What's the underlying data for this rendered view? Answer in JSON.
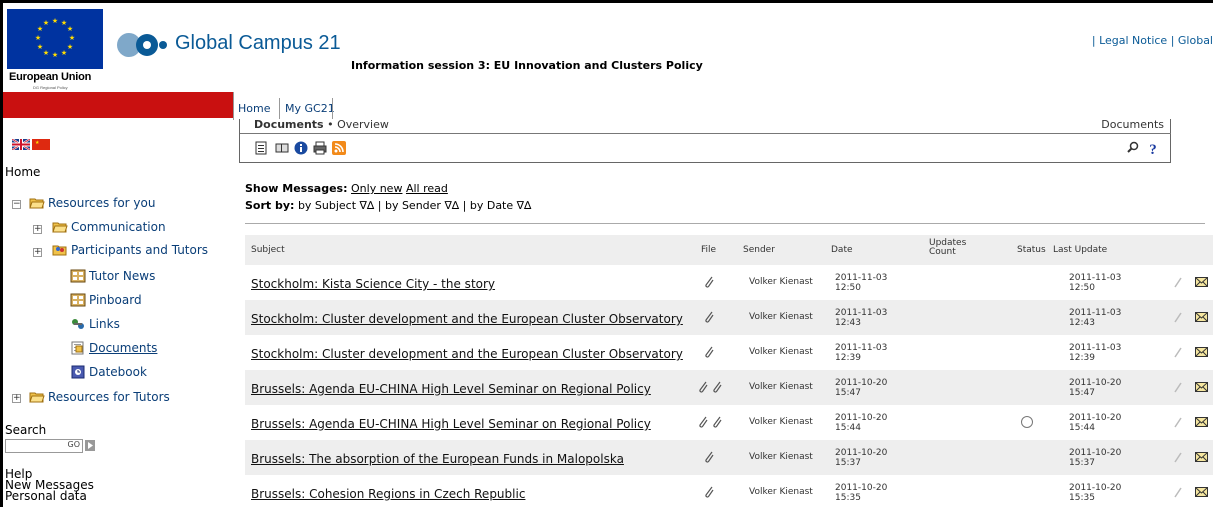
{
  "header": {
    "eu_label": "European Union",
    "eu_sub": "DG Regional Policy",
    "site_title": "Global Campus 21",
    "session_title": "Information session 3: EU Innovation and Clusters Policy",
    "top_links": "| Legal Notice | Global"
  },
  "tabs": {
    "home": "Home",
    "mygc": "My GC21"
  },
  "sidebar": {
    "home": "Home",
    "resources_you": "Resources for you",
    "communication": "Communication",
    "participants": "Participants and Tutors",
    "tutor_news": "Tutor News",
    "pinboard": "Pinboard",
    "links": "Links",
    "documents": "Documents",
    "datebook": "Datebook",
    "resources_tutors": "Resources for Tutors",
    "search_label": "Search",
    "search_go": "GO",
    "help": "Help",
    "new_messages": "New Messages",
    "personal_data": "Personal data"
  },
  "doc": {
    "breadcrumb_section": "Documents",
    "breadcrumb_sep": " • ",
    "breadcrumb_page": "Overview",
    "right_label": "Documents"
  },
  "filters": {
    "show_label": "Show Messages:",
    "only_new": "Only new",
    "all_read": "All read",
    "sort_label": "Sort by:",
    "sort_text": "by Subject ∇∆ | by Sender ∇∆ | by Date ∇∆"
  },
  "table": {
    "headers": {
      "subject": "Subject",
      "file": "File",
      "sender": "Sender",
      "date": "Date",
      "updates1": "Updates",
      "updates2": "Count",
      "status": "Status",
      "last_update": "Last Update"
    },
    "rows": [
      {
        "subject": "Stockholm: Kista Science City - the story",
        "sender": "Volker Kienast",
        "date": "2011-11-03",
        "time": "12:50",
        "ldate": "2011-11-03",
        "ltime": "12:50"
      },
      {
        "subject": "Stockholm: Cluster development and the European Cluster Observatory",
        "sender": "Volker Kienast",
        "date": "2011-11-03",
        "time": "12:43",
        "ldate": "2011-11-03",
        "ltime": "12:43"
      },
      {
        "subject": "Stockholm: Cluster development and the European Cluster Observatory",
        "sender": "Volker Kienast",
        "date": "2011-11-03",
        "time": "12:39",
        "ldate": "2011-11-03",
        "ltime": "12:39"
      },
      {
        "subject": "Brussels: Agenda EU-CHINA High Level Seminar on Regional Policy",
        "sender": "Volker Kienast",
        "date": "2011-10-20",
        "time": "15:47",
        "ldate": "2011-10-20",
        "ltime": "15:47"
      },
      {
        "subject": "Brussels: Agenda EU-CHINA High Level Seminar on Regional Policy",
        "sender": "Volker Kienast",
        "date": "2011-10-20",
        "time": "15:44",
        "ldate": "2011-10-20",
        "ltime": "15:44"
      },
      {
        "subject": "Brussels: The absorption of the European Funds in Malopolska",
        "sender": "Volker Kienast",
        "date": "2011-10-20",
        "time": "15:37",
        "ldate": "2011-10-20",
        "ltime": "15:37"
      },
      {
        "subject": "Brussels: Cohesion Regions in Czech Republic",
        "sender": "Volker Kienast",
        "date": "2011-10-20",
        "time": "15:35",
        "ldate": "2011-10-20",
        "ltime": "15:35"
      }
    ]
  }
}
